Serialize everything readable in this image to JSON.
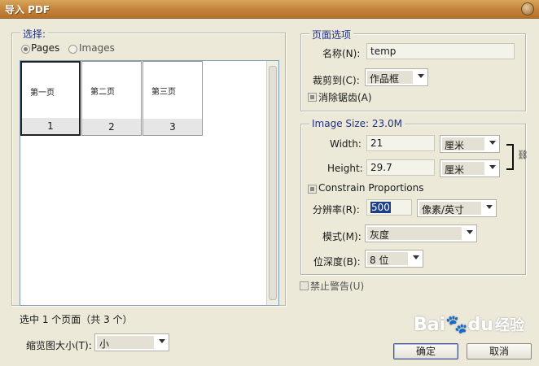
{
  "window": {
    "title": "导入 PDF"
  },
  "select_group": {
    "legend": "选择:",
    "radio_pages": "Pages",
    "radio_images": "Images",
    "thumbnails": [
      {
        "text": "第一页",
        "number": "1",
        "selected": true
      },
      {
        "text": "第二页",
        "number": "2",
        "selected": false
      },
      {
        "text": "第三页",
        "number": "3",
        "selected": false
      }
    ],
    "status": "选中 1 个页面（共 3 个）",
    "thumb_size_label": "缩览图大小(T):",
    "thumb_size_value": "小"
  },
  "page_options": {
    "legend": "页面选项",
    "name_label": "名称(N):",
    "name_value": "temp",
    "crop_label": "裁剪到(C):",
    "crop_value": "作品框",
    "antialias_label": "消除锯齿(A)"
  },
  "image_size": {
    "legend": "Image Size: 23.0M",
    "width_label": "Width:",
    "width_value": "21",
    "width_unit": "厘米",
    "height_label": "Height:",
    "height_value": "29.7",
    "height_unit": "厘米",
    "constrain_label": "Constrain Proportions",
    "resolution_label": "分辨率(R):",
    "resolution_value": "500",
    "resolution_unit": "像素/英寸",
    "mode_label": "模式(M):",
    "mode_value": "灰度",
    "depth_label": "位深度(B):",
    "depth_value": "8 位"
  },
  "suppress_warnings_label": "禁止警告(U)",
  "buttons": {
    "ok": "确定",
    "cancel": "取消"
  },
  "watermark": {
    "brand": "Bai",
    "brand2": "du",
    "sub": "经验"
  },
  "colors": {
    "title_bar": "#c4853c",
    "legend_text": "#22308a",
    "selection": "#1d3e88"
  }
}
